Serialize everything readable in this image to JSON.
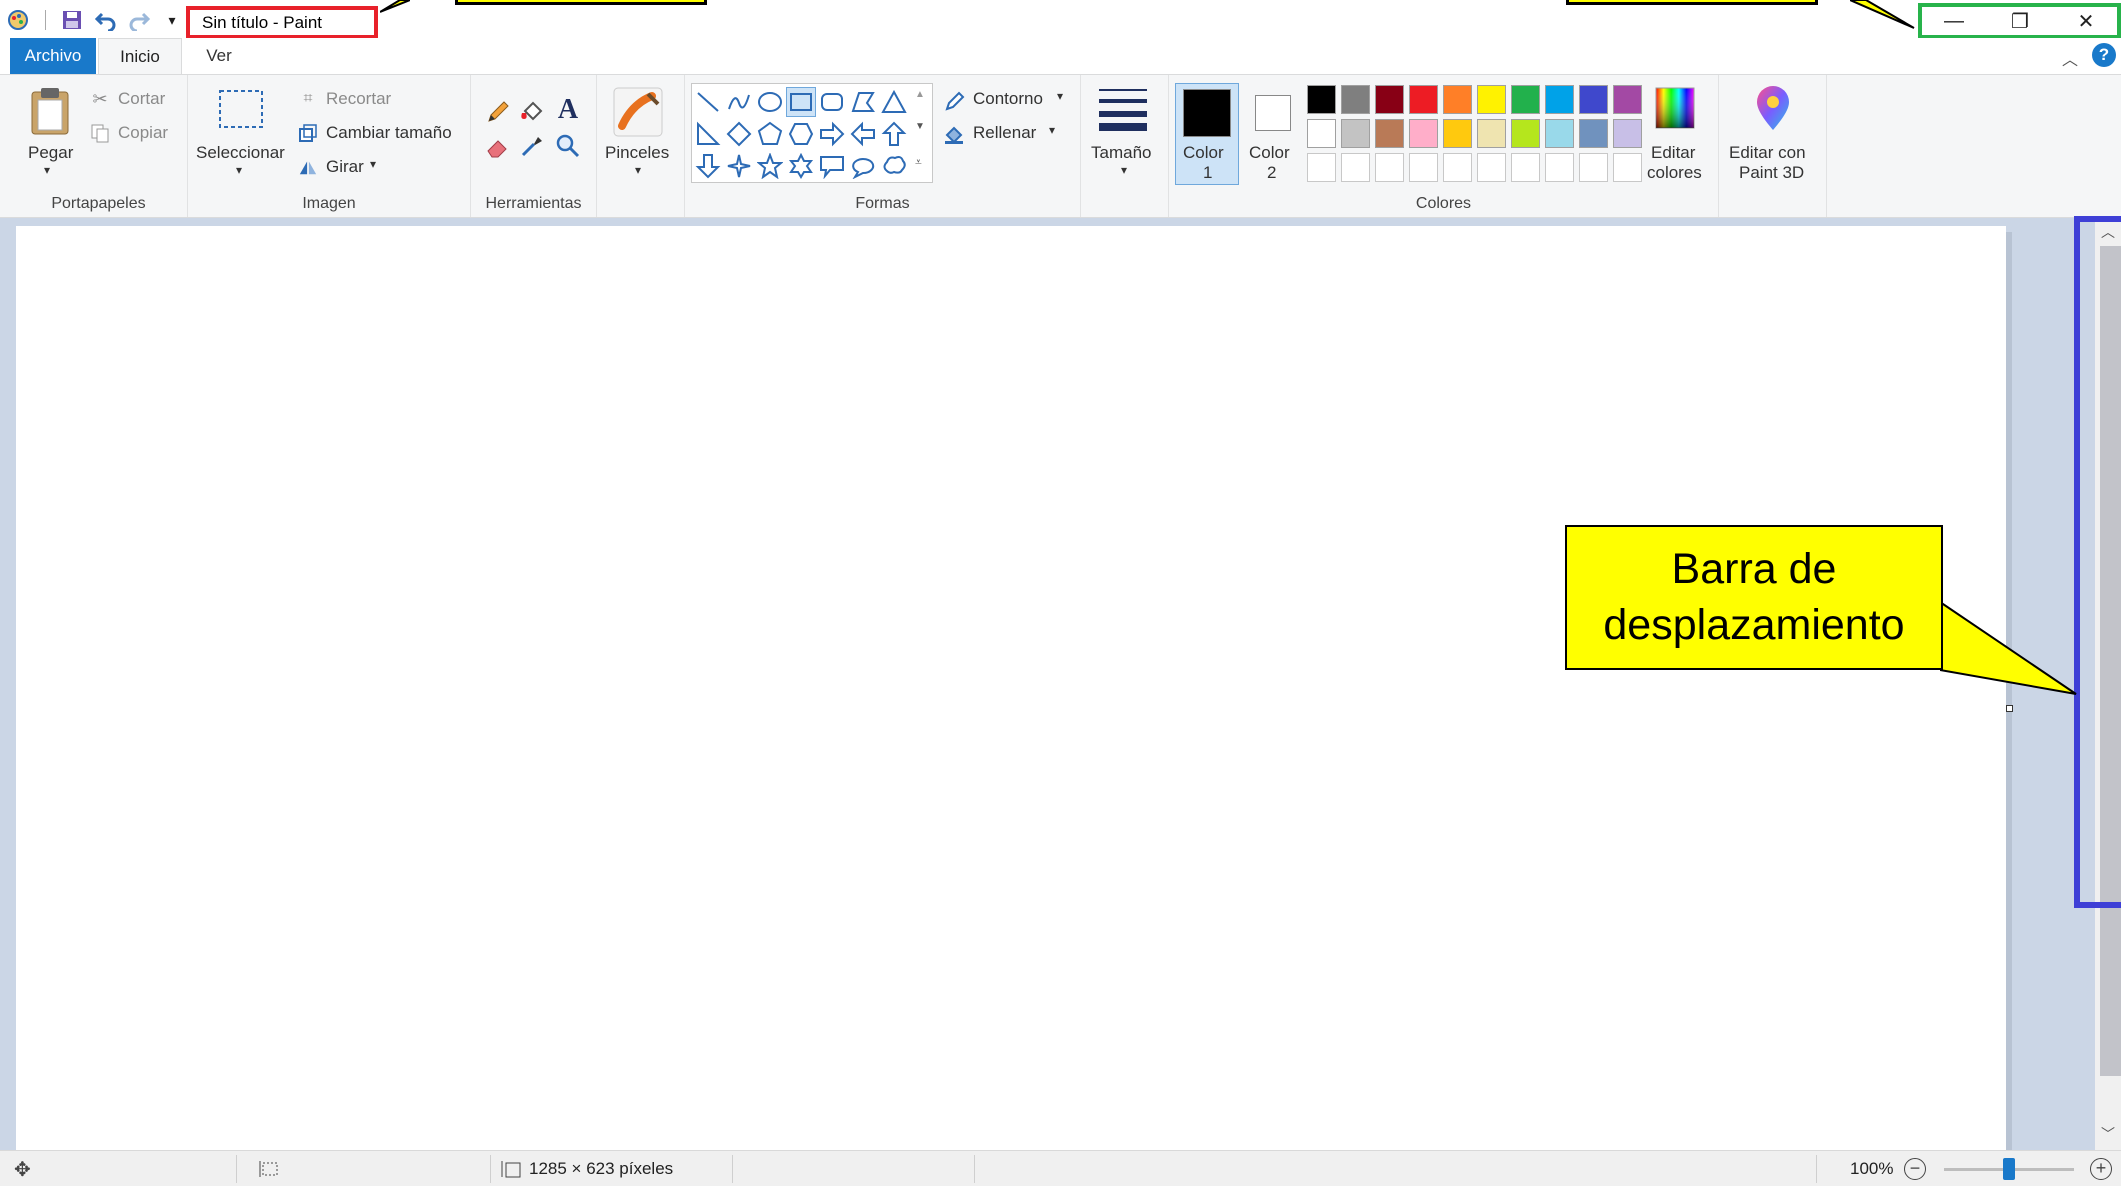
{
  "window": {
    "title": "Sin título - Paint",
    "controls": {
      "minimize": "—",
      "restore": "❐",
      "close": "✕"
    }
  },
  "tabs": [
    {
      "label": "Archivo",
      "active": false
    },
    {
      "label": "Inicio",
      "active": true
    },
    {
      "label": "Ver",
      "active": false
    }
  ],
  "ribbon": {
    "clipboard": {
      "paste": "Pegar",
      "cut": "Cortar",
      "copy": "Copiar",
      "group": "Portapapeles"
    },
    "image": {
      "select": "Seleccionar",
      "crop": "Recortar",
      "resize": "Cambiar tamaño",
      "rotate": "Girar",
      "group": "Imagen"
    },
    "tools": {
      "group": "Herramientas",
      "icons": [
        "pencil-icon",
        "fill-icon",
        "text-icon",
        "eraser-icon",
        "color-picker-icon",
        "magnifier-icon"
      ]
    },
    "brushes": {
      "label": "Pinceles"
    },
    "shapes": {
      "outline": "Contorno",
      "fill": "Rellenar",
      "group": "Formas"
    },
    "size": {
      "label": "Tamaño"
    },
    "colors": {
      "color1_top": "Color",
      "color1_bottom": "1",
      "color2_top": "Color",
      "color2_bottom": "2",
      "edit_top": "Editar",
      "edit_bottom": "colores",
      "group": "Colores",
      "row1": [
        "#000000",
        "#7f7f7f",
        "#880015",
        "#ed1c24",
        "#ff7f27",
        "#fff200",
        "#22b14c",
        "#00a2e8",
        "#3f48cc",
        "#a349a4"
      ],
      "row2": [
        "#ffffff",
        "#c3c3c3",
        "#b97a57",
        "#ffaec9",
        "#ffc90e",
        "#efe4b0",
        "#b5e61d",
        "#99d9ea",
        "#7092be",
        "#c8bfe7"
      ]
    },
    "paint3d": {
      "line1": "Editar con",
      "line2": "Paint 3D"
    }
  },
  "callout": {
    "line1": "Barra de",
    "line2": "desplazamiento"
  },
  "status": {
    "dimensions": "1285 × 623 píxeles",
    "zoom": "100%",
    "zoom_level": 1.0
  }
}
